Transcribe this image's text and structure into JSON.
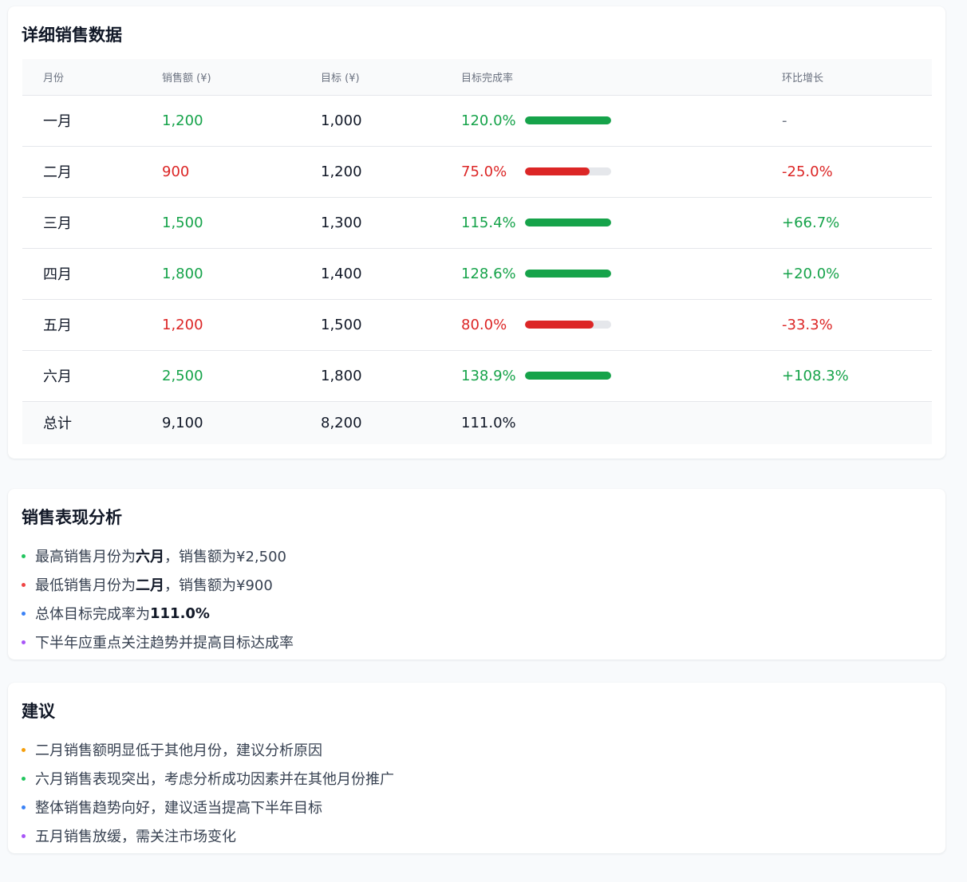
{
  "table_card": {
    "title": "详细销售数据",
    "headers": [
      "月份",
      "销售额 (¥)",
      "目标 (¥)",
      "目标完成率",
      "环比增长"
    ],
    "rows": [
      {
        "month": "一月",
        "sales": "1,200",
        "target": "1,000",
        "rate": "120.0%",
        "rate_fraction": 1.0,
        "growth": "-",
        "status": "good",
        "growth_status": "neutral"
      },
      {
        "month": "二月",
        "sales": "900",
        "target": "1,200",
        "rate": "75.0%",
        "rate_fraction": 0.75,
        "growth": "-25.0%",
        "status": "bad",
        "growth_status": "bad"
      },
      {
        "month": "三月",
        "sales": "1,500",
        "target": "1,300",
        "rate": "115.4%",
        "rate_fraction": 1.0,
        "growth": "+66.7%",
        "status": "good",
        "growth_status": "good"
      },
      {
        "month": "四月",
        "sales": "1,800",
        "target": "1,400",
        "rate": "128.6%",
        "rate_fraction": 1.0,
        "growth": "+20.0%",
        "status": "good",
        "growth_status": "good"
      },
      {
        "month": "五月",
        "sales": "1,200",
        "target": "1,500",
        "rate": "80.0%",
        "rate_fraction": 0.8,
        "growth": "-33.3%",
        "status": "bad",
        "growth_status": "bad"
      },
      {
        "month": "六月",
        "sales": "2,500",
        "target": "1,800",
        "rate": "138.9%",
        "rate_fraction": 1.0,
        "growth": "+108.3%",
        "status": "good",
        "growth_status": "good"
      }
    ],
    "total": {
      "label": "总计",
      "sales": "9,100",
      "target": "8,200",
      "rate": "111.0%"
    }
  },
  "analysis_card": {
    "title": "销售表现分析",
    "items": [
      {
        "prefix": "最高销售月份为",
        "bold": "六月",
        "suffix": "，销售额为¥2,500",
        "dot_color": "#22c55e"
      },
      {
        "prefix": "最低销售月份为",
        "bold": "二月",
        "suffix": "，销售额为¥900",
        "dot_color": "#ef4444"
      },
      {
        "prefix": "总体目标完成率为",
        "bold": "111.0%",
        "suffix": "",
        "dot_color": "#3b82f6"
      },
      {
        "prefix": "下半年应重点关注趋势并提高目标达成率",
        "bold": "",
        "suffix": "",
        "dot_color": "#a855f7"
      }
    ]
  },
  "advice_card": {
    "title": "建议",
    "items": [
      {
        "text": "二月销售额明显低于其他月份，建议分析原因",
        "dot_color": "#f59e0b"
      },
      {
        "text": "六月销售表现突出，考虑分析成功因素并在其他月份推广",
        "dot_color": "#22c55e"
      },
      {
        "text": "整体销售趋势向好，建议适当提高下半年目标",
        "dot_color": "#3b82f6"
      },
      {
        "text": "五月销售放缓，需关注市场变化",
        "dot_color": "#a855f7"
      }
    ]
  },
  "colors": {
    "good": "#16a34a",
    "bad": "#dc2626",
    "track": "#e5e7eb"
  }
}
